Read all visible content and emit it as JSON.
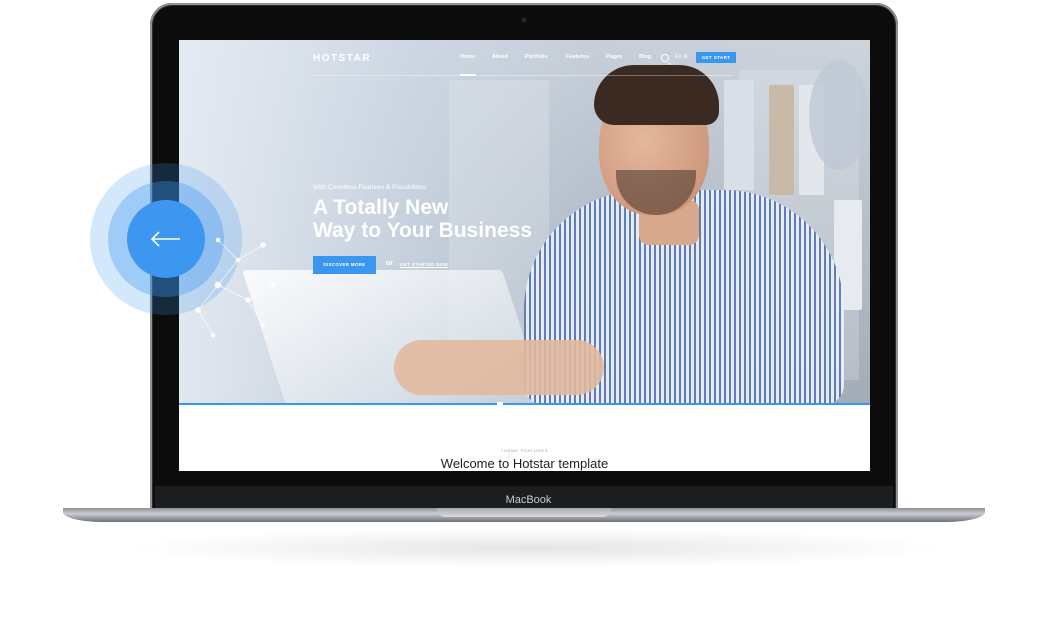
{
  "device": {
    "label": "MacBook"
  },
  "site": {
    "logo": "HOTSTAR",
    "nav": {
      "items": [
        "Home",
        "About",
        "Portfolio",
        "Features",
        "Pages",
        "Blog"
      ],
      "active": "Home",
      "language": "En ⊕",
      "cta": "GET START"
    },
    "hero": {
      "kicker": "With Countless Features & Possibilities",
      "title_line1": "A Totally New",
      "title_line2": "Way to Your Business",
      "primary_button": "DISCOVER MORE",
      "or": "or",
      "secondary_link": "GET STARTED NOW"
    },
    "section": {
      "eyebrow": "THEME FEATURES",
      "welcome_bold": "Welcome",
      "welcome_rest": " to Hotstar template"
    }
  },
  "colors": {
    "accent": "#3d96f0",
    "bezel": "#0c0c0c"
  },
  "icons": {
    "back": "arrow-left-icon",
    "search": "search-icon"
  }
}
